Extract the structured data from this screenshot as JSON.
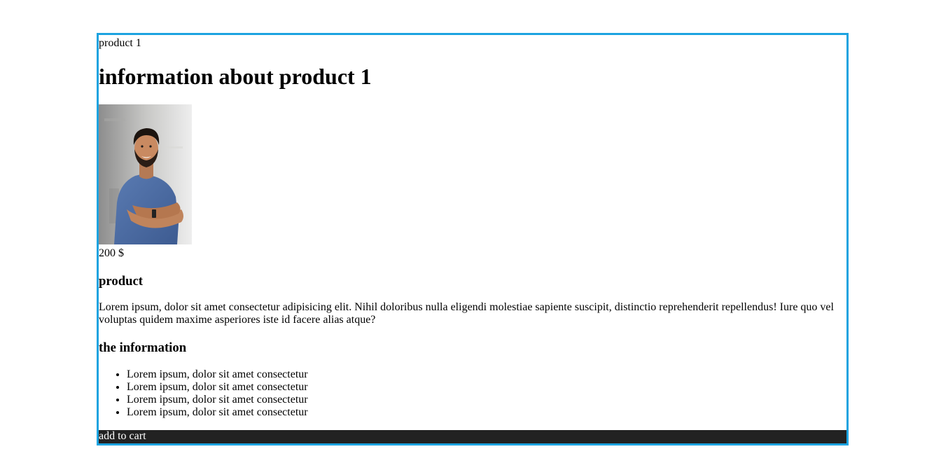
{
  "product": {
    "breadcrumb": "product 1",
    "title": "information about product 1",
    "photo_alt": "product photo",
    "price": "200 $",
    "section_heading": "product",
    "description": "Lorem ipsum, dolor sit amet consectetur adipisicing elit. Nihil doloribus nulla eligendi molestiae sapiente suscipit, distinctio reprehenderit repellendus! Iure quo vel voluptas quidem maxime asperiores iste id facere alias atque?",
    "info_heading": "the information",
    "info_items": [
      "Lorem ipsum, dolor sit amet consectetur",
      "Lorem ipsum, dolor sit amet consectetur",
      "Lorem ipsum, dolor sit amet consectetur",
      "Lorem ipsum, dolor sit amet consectetur"
    ],
    "cart_label": "add to cart"
  },
  "colors": {
    "card_border": "#1ca3e0",
    "cart_background": "#222222",
    "cart_text": "#ffffff"
  }
}
